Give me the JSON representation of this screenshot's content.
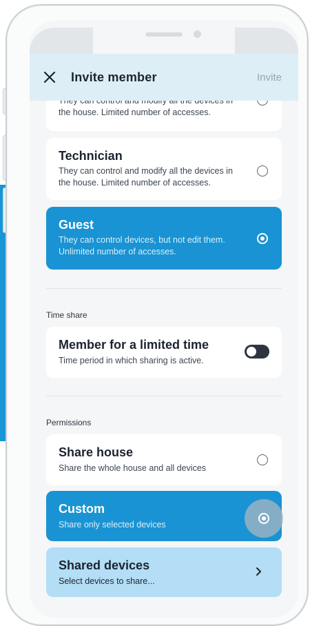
{
  "header": {
    "title": "Invite member",
    "action_label": "Invite"
  },
  "roles": [
    {
      "title": "",
      "description": "They can control and modify all the devices in the house. Limited number of accesses.",
      "selected": false
    },
    {
      "title": "Technician",
      "description": "They can control and modify all the devices in the house. Limited number of accesses.",
      "selected": false
    },
    {
      "title": "Guest",
      "description": "They can control devices, but not edit them. Unlimited number of accesses.",
      "selected": true
    }
  ],
  "time_share": {
    "section_label": "Time share",
    "title": "Member for a limited time",
    "description": "Time period in which sharing is active.",
    "enabled": false
  },
  "permissions": {
    "section_label": "Permissions",
    "options": [
      {
        "title": "Share house",
        "description": "Share the whole house and all devices",
        "selected": false
      },
      {
        "title": "Custom",
        "description": "Share only selected devices",
        "selected": true
      }
    ],
    "shared_devices": {
      "title": "Shared devices",
      "description": "Select devices to share..."
    }
  },
  "colors": {
    "accent": "#1993d3",
    "header_bg": "#deeef6",
    "light_card": "#b3def5"
  },
  "icons": {
    "close": "close-icon",
    "radio_off": "radio-unselected-icon",
    "radio_on": "radio-selected-icon",
    "chevron": "chevron-right-icon"
  }
}
